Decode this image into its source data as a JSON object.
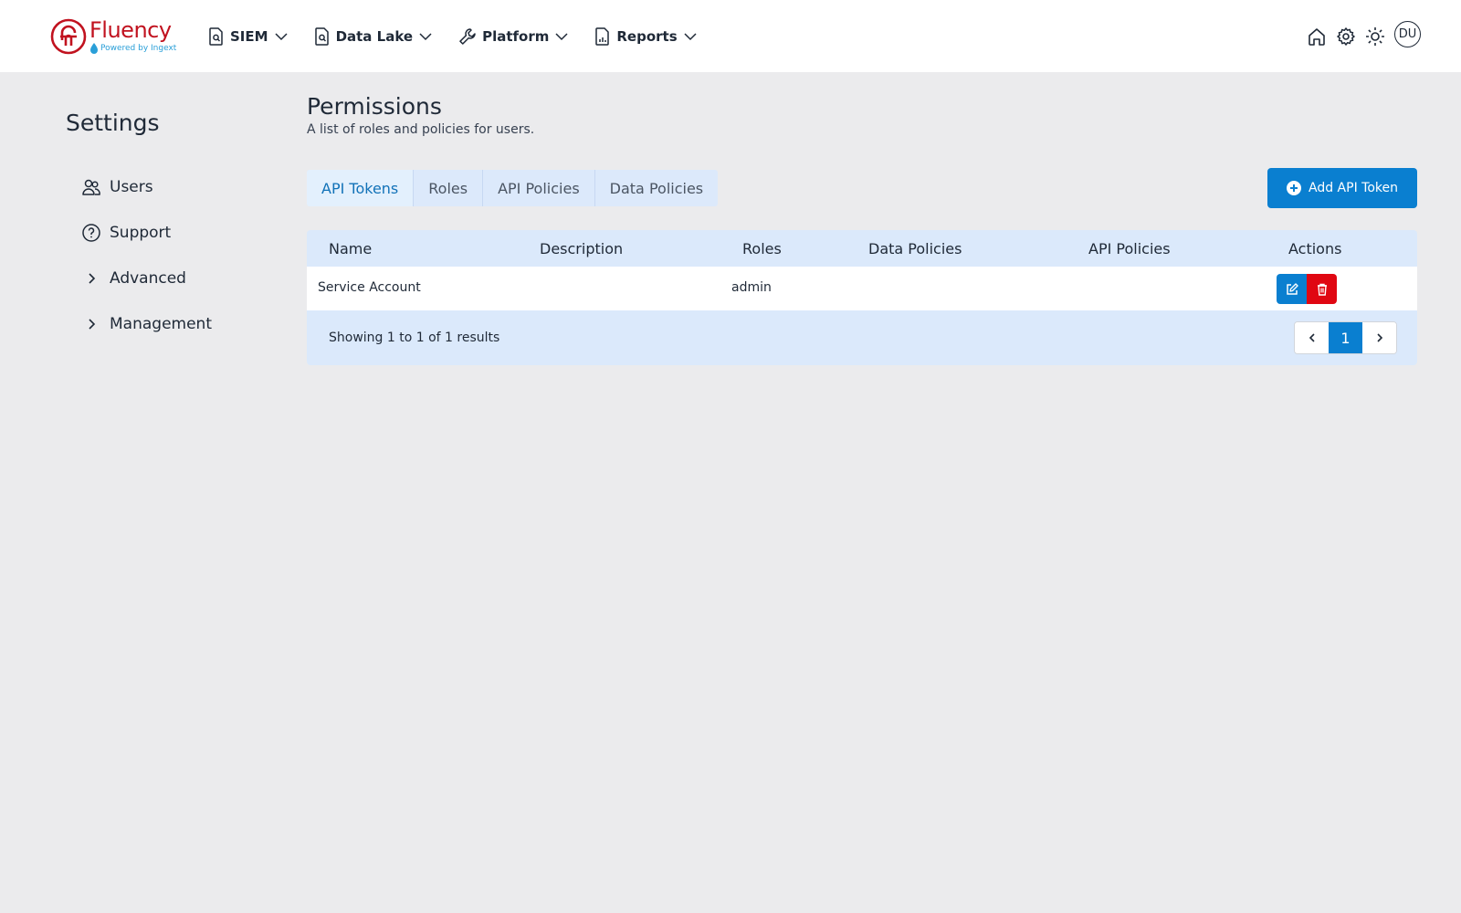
{
  "brand": {
    "name": "Fluency",
    "tagline": "Powered by Ingext",
    "color": "#c1121f"
  },
  "nav": {
    "items": [
      {
        "label": "SIEM",
        "icon": "file-search-icon"
      },
      {
        "label": "Data Lake",
        "icon": "file-search-icon"
      },
      {
        "label": "Platform",
        "icon": "wrench-icon"
      },
      {
        "label": "Reports",
        "icon": "file-chart-icon"
      }
    ],
    "right": {
      "avatar": "DU"
    }
  },
  "sidebar": {
    "title": "Settings",
    "items": [
      {
        "label": "Users",
        "icon": "users-icon"
      },
      {
        "label": "Support",
        "icon": "question-circle-icon"
      },
      {
        "label": "Advanced",
        "icon": "chevron-right-icon"
      },
      {
        "label": "Management",
        "icon": "chevron-right-icon"
      }
    ]
  },
  "main": {
    "title": "Permissions",
    "subtitle": "A list of roles and policies for users.",
    "tabs": [
      "API Tokens",
      "Roles",
      "API Policies",
      "Data Policies"
    ],
    "active_tab": "API Tokens",
    "add_button": "Add API Token",
    "table": {
      "headers": [
        "Name",
        "Description",
        "Roles",
        "Data Policies",
        "API Policies",
        "Actions"
      ],
      "rows": [
        {
          "name": "Service Account",
          "description": "",
          "roles": "admin",
          "data_policies": "",
          "api_policies": ""
        }
      ],
      "showing": "Showing 1 to 1 of 1 results",
      "current_page": "1"
    }
  },
  "colors": {
    "primary": "#0a7fd0",
    "danger": "#e00712",
    "table_bg": "#dbe9fb"
  }
}
